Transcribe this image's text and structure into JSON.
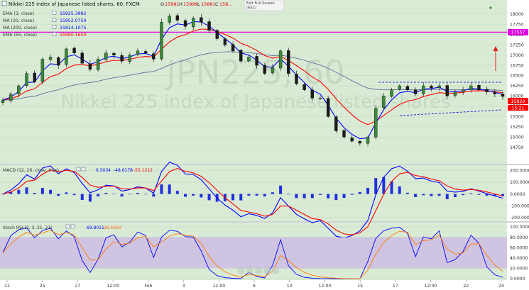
{
  "chart_data": {
    "type": "candlestick",
    "main": {
      "title": "Nikkei 225 index of Japanese listed shares, 60, FXCM",
      "ohlc": {
        "O": "15991",
        "H": "15999",
        "L": "15881",
        "C": "158…"
      },
      "watermark_symbol": "JPN225, 60",
      "watermark_name": "Nikkei 225 index of Japanese listed shares",
      "popup_line1": "Exit Full Screen",
      "popup_line2": "(ESC)",
      "ylim": [
        14400,
        18100
      ],
      "yticks": [
        "18000",
        "17750",
        "17500",
        "17250",
        "17000",
        "16750",
        "16500",
        "16250",
        "16000",
        "15750",
        "15500",
        "15250",
        "15000",
        "14750"
      ],
      "price_level": "17557",
      "last_price": "15829",
      "last_time": "15:21",
      "indicators": [
        {
          "name": "EMA (3, close)",
          "value": "15925.3992",
          "color": "#0000ff"
        },
        {
          "name": "MA (20, close)",
          "value": "15952.0750",
          "color": "#0000ff"
        },
        {
          "name": "MA (200, close)",
          "value": "15814.1075",
          "color": "#0000ff"
        },
        {
          "name": "EMA (55, close)",
          "value": "15990.1650",
          "color": "#ff0000"
        }
      ],
      "closes": [
        15900,
        16050,
        16250,
        16550,
        16350,
        16900,
        16950,
        16750,
        17150,
        17050,
        16800,
        16650,
        16900,
        17050,
        17000,
        16850,
        17000,
        17100,
        17050,
        16900,
        17800,
        17950,
        17850,
        17700,
        17900,
        17800,
        17600,
        17400,
        17250,
        17100,
        16850,
        16950,
        16750,
        16550,
        16700,
        17100,
        16550,
        16300,
        16150,
        15950,
        15950,
        15500,
        15150,
        15000,
        14900,
        14850,
        15000,
        15700,
        16000,
        16150,
        16250,
        16150,
        16050,
        16250,
        16200,
        16250,
        16000,
        16100,
        16150,
        16250,
        16150,
        16100,
        16050,
        15990
      ]
    },
    "macd": {
      "label": "MACD (12, 26, close, true)",
      "values": {
        "macd": "6.5034",
        "signal": "-48.6178",
        "hist": "-55.1212"
      },
      "ylim": [
        -220,
        215
      ],
      "yticks": [
        "200.0000",
        "100.0000",
        "0.0000",
        "-100.0000",
        "-200.0000"
      ]
    },
    "stoch_rsi": {
      "label": "Stoch RSI (3, 3, 21, 21)",
      "values": {
        "k": "69.8011",
        "d": "36.5050"
      },
      "ylim": [
        0,
        100
      ],
      "yticks": [
        "100.0000",
        "80.0000",
        "60.0000",
        "40.0000",
        "20.0000",
        "0.0000"
      ]
    },
    "xticks": [
      "21",
      "25",
      "27",
      "12:00",
      "Feb",
      "3",
      "12:00",
      "6",
      "10",
      "12:00",
      "15",
      "17",
      "12:00",
      "22",
      "24"
    ]
  },
  "colors": {
    "background": "#daebd5",
    "up": "#3a8a3a",
    "down": "#1a1a1a",
    "ema_fast": "#0000ff",
    "ema_slow": "#ff0000",
    "ma_long": "#5d6d9a",
    "level_line": "#e000e0",
    "rsi_band": "#cdbde3",
    "last_price_label": "#ff0000"
  }
}
